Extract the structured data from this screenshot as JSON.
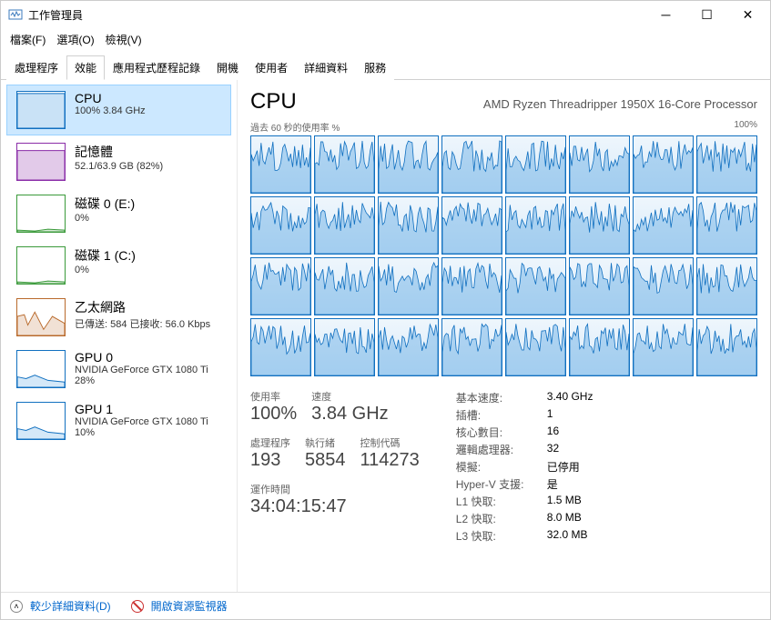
{
  "window": {
    "title": "工作管理員"
  },
  "menubar": [
    "檔案(F)",
    "選項(O)",
    "檢視(V)"
  ],
  "tabs": [
    "處理程序",
    "效能",
    "應用程式歷程記錄",
    "開機",
    "使用者",
    "詳細資料",
    "服務"
  ],
  "active_tab": 1,
  "sidebar": [
    {
      "title": "CPU",
      "detail": "100%  3.84 GHz",
      "color": "#1170c0",
      "fill": "rgba(40,140,220,0.25)",
      "selected": true
    },
    {
      "title": "記憶體",
      "detail": "52.1/63.9 GB (82%)",
      "color": "#8a2da8",
      "fill": "rgba(138,45,168,0.25)"
    },
    {
      "title": "磁碟 0 (E:)",
      "detail": "0%",
      "color": "#3a9a3a",
      "fill": "rgba(58,154,58,0.2)"
    },
    {
      "title": "磁碟 1 (C:)",
      "detail": "0%",
      "color": "#3a9a3a",
      "fill": "rgba(58,154,58,0.2)"
    },
    {
      "title": "乙太網路",
      "detail": "已傳送: 584 已接收: 56.0 Kbps",
      "color": "#b96a2c",
      "fill": "rgba(185,106,44,0.2)"
    },
    {
      "title": "GPU 0",
      "detail": "NVIDIA GeForce GTX 1080 Ti\n28%",
      "color": "#1170c0",
      "fill": "rgba(40,140,220,0.2)"
    },
    {
      "title": "GPU 1",
      "detail": "NVIDIA GeForce GTX 1080 Ti\n10%",
      "color": "#1170c0",
      "fill": "rgba(40,140,220,0.2)"
    }
  ],
  "main": {
    "title": "CPU",
    "subtitle": "AMD Ryzen Threadripper 1950X 16-Core Processor",
    "chart_left": "過去 60 秒的使用率 %",
    "chart_right": "100%",
    "cores": 32,
    "stats": {
      "usage_label": "使用率",
      "usage": "100%",
      "speed_label": "速度",
      "speed": "3.84 GHz",
      "processes_label": "處理程序",
      "processes": "193",
      "threads_label": "執行緒",
      "threads": "5854",
      "handles_label": "控制代碼",
      "handles": "114273",
      "uptime_label": "運作時間",
      "uptime": "34:04:15:47"
    },
    "info": [
      {
        "k": "基本速度:",
        "v": "3.40 GHz"
      },
      {
        "k": "插槽:",
        "v": "1"
      },
      {
        "k": "核心數目:",
        "v": "16"
      },
      {
        "k": "邏輯處理器:",
        "v": "32"
      },
      {
        "k": "模擬:",
        "v": "已停用"
      },
      {
        "k": "Hyper-V 支援:",
        "v": "是"
      },
      {
        "k": "L1 快取:",
        "v": "1.5 MB"
      },
      {
        "k": "L2 快取:",
        "v": "8.0 MB"
      },
      {
        "k": "L3 快取:",
        "v": "32.0 MB"
      }
    ]
  },
  "footer": {
    "fewer": "較少詳細資料(D)",
    "resmon": "開啟資源監視器"
  },
  "chart_data": {
    "type": "line",
    "title": "CPU core utilization (32 logical processors)",
    "xlabel": "過去 60 秒",
    "ylabel": "%",
    "ylim": [
      0,
      100
    ],
    "note": "32 mini-charts, all fluctuating roughly 60–100% with overall usage at 100%"
  }
}
